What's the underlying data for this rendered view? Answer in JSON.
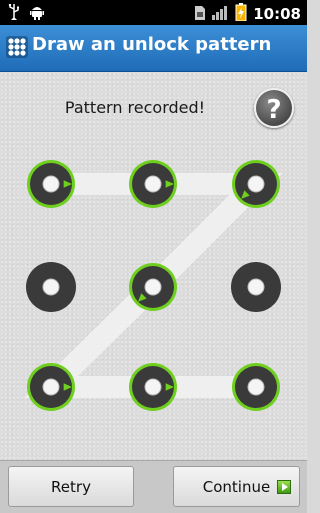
{
  "status_bar": {
    "time": "10:08",
    "icons": [
      "usb-icon",
      "android-debug-icon",
      "sim-icon",
      "signal-icon",
      "battery-charging-icon"
    ]
  },
  "title_bar": {
    "title": "Draw an unlock pattern",
    "icon": "grid-icon"
  },
  "main": {
    "status_text": "Pattern recorded!",
    "help_label": "?",
    "grid": {
      "rows": 3,
      "cols": 3,
      "selected_nodes": [
        0,
        1,
        2,
        4,
        6,
        7,
        8
      ],
      "pattern_path": [
        0,
        1,
        2,
        4,
        6,
        7,
        8
      ]
    },
    "colors": {
      "selected_ring": "#6fcf1f",
      "node_fill": "#3a3a3a",
      "path": "#f2f2f2"
    }
  },
  "buttons": {
    "retry": "Retry",
    "continue": "Continue"
  }
}
